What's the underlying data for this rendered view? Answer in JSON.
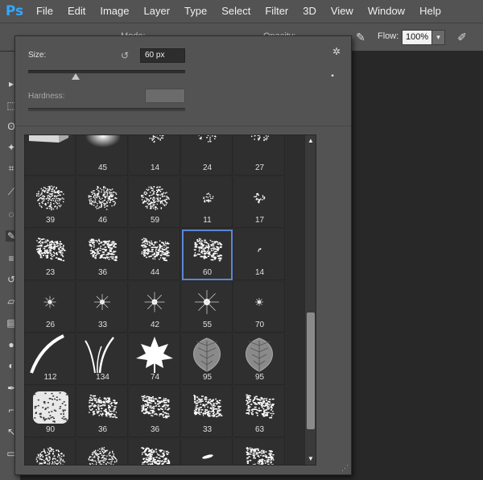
{
  "app": {
    "logo": "Ps"
  },
  "menu": [
    "File",
    "Edit",
    "Image",
    "Layer",
    "Type",
    "Select",
    "Filter",
    "3D",
    "View",
    "Window",
    "Help"
  ],
  "options": {
    "mode_label": "Mode:",
    "opacity_label": "Opacity:",
    "flow_label": "Flow:",
    "flow_value": "100%",
    "dropdown_arrow": "▾"
  },
  "picker": {
    "size_label": "Size:",
    "size_value": "60 px",
    "size_fraction": 0.3,
    "hardness_label": "Hardness:",
    "icons": [
      "reset-icon",
      "gear-icon",
      "new-preset-icon",
      "resize-grip-icon"
    ],
    "brushes": [
      {
        "num": "",
        "kind": "pencil"
      },
      {
        "num": "45",
        "kind": "soft"
      },
      {
        "num": "14",
        "kind": "dots"
      },
      {
        "num": "24",
        "kind": "dots"
      },
      {
        "num": "27",
        "kind": "dots"
      },
      {
        "num": "39",
        "kind": "spatter"
      },
      {
        "num": "46",
        "kind": "spatter"
      },
      {
        "num": "59",
        "kind": "spatter"
      },
      {
        "num": "11",
        "kind": "small"
      },
      {
        "num": "17",
        "kind": "small"
      },
      {
        "num": "23",
        "kind": "chalk"
      },
      {
        "num": "36",
        "kind": "chalk"
      },
      {
        "num": "44",
        "kind": "chalk"
      },
      {
        "num": "60",
        "kind": "chalk",
        "selected": true
      },
      {
        "num": "14",
        "kind": "tiny"
      },
      {
        "num": "26",
        "kind": "star"
      },
      {
        "num": "33",
        "kind": "star"
      },
      {
        "num": "42",
        "kind": "star"
      },
      {
        "num": "55",
        "kind": "star"
      },
      {
        "num": "70",
        "kind": "star"
      },
      {
        "num": "112",
        "kind": "grass1"
      },
      {
        "num": "134",
        "kind": "grass2"
      },
      {
        "num": "74",
        "kind": "maple"
      },
      {
        "num": "95",
        "kind": "leaf"
      },
      {
        "num": "95",
        "kind": "leaf"
      },
      {
        "num": "90",
        "kind": "rough"
      },
      {
        "num": "36",
        "kind": "chalk"
      },
      {
        "num": "36",
        "kind": "chalk"
      },
      {
        "num": "33",
        "kind": "chalk"
      },
      {
        "num": "63",
        "kind": "chalk"
      },
      {
        "num": "",
        "kind": "spatter"
      },
      {
        "num": "",
        "kind": "spatter"
      },
      {
        "num": "",
        "kind": "chalk"
      },
      {
        "num": "",
        "kind": "dash"
      },
      {
        "num": "",
        "kind": "chalk"
      }
    ]
  }
}
